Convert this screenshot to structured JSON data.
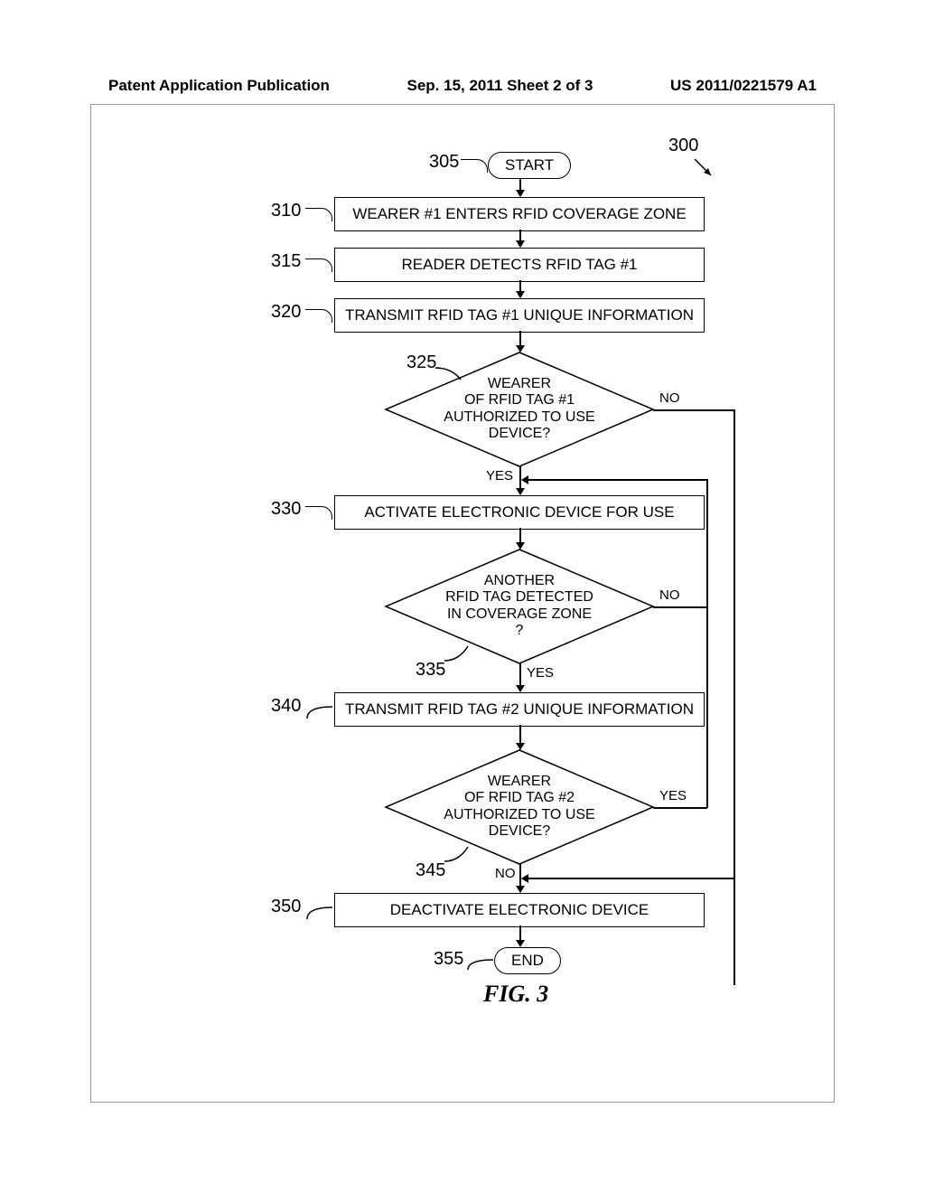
{
  "header": {
    "left": "Patent Application Publication",
    "center": "Sep. 15, 2011  Sheet 2 of 3",
    "right": "US 2011/0221579 A1"
  },
  "refs": {
    "r300": "300",
    "r305": "305",
    "r310": "310",
    "r315": "315",
    "r320": "320",
    "r325": "325",
    "r330": "330",
    "r335": "335",
    "r340": "340",
    "r345": "345",
    "r350": "350",
    "r355": "355"
  },
  "nodes": {
    "start": "START",
    "step310": "WEARER #1 ENTERS RFID COVERAGE ZONE",
    "step315": "READER DETECTS RFID TAG #1",
    "step320": "TRANSMIT RFID TAG #1 UNIQUE INFORMATION",
    "dec325_l1": "WEARER",
    "dec325_l2": "OF RFID TAG #1",
    "dec325_l3": "AUTHORIZED TO USE",
    "dec325_l4": "DEVICE?",
    "step330": "ACTIVATE ELECTRONIC DEVICE FOR USE",
    "dec335_l1": "ANOTHER",
    "dec335_l2": "RFID TAG DETECTED",
    "dec335_l3": "IN COVERAGE ZONE",
    "dec335_l4": "?",
    "step340": "TRANSMIT RFID TAG #2 UNIQUE INFORMATION",
    "dec345_l1": "WEARER",
    "dec345_l2": "OF RFID TAG #2",
    "dec345_l3": "AUTHORIZED TO USE",
    "dec345_l4": "DEVICE?",
    "step350": "DEACTIVATE ELECTRONIC DEVICE",
    "end": "END"
  },
  "labels": {
    "yes": "YES",
    "no": "NO"
  },
  "figure": "FIG. 3"
}
